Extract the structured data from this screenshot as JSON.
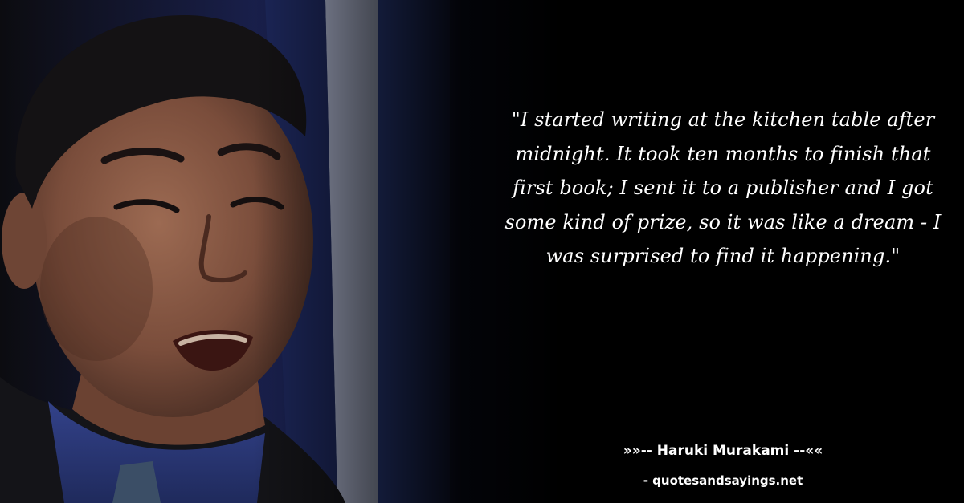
{
  "photo": {
    "subject": "man-speaking-portrait",
    "colors": {
      "background_blue": "#2a3f8a",
      "background_white": "#cfd4e2",
      "skin": "#8a5a45",
      "hair": "#141214",
      "shirt": "#2c3a7a",
      "jacket": "#151518",
      "tie": "#3a4d63"
    }
  },
  "quote": {
    "text": "\"I started writing at the kitchen table after midnight. It took ten months to finish that first book; I sent it to a publisher and I got some kind of prize, so it was like a dream - I was surprised to find it happening.\""
  },
  "attribution": {
    "prefix": "»»-- ",
    "author": "Haruki Murakami",
    "suffix": " --««"
  },
  "source": {
    "text": "- quotesandsayings.net"
  }
}
